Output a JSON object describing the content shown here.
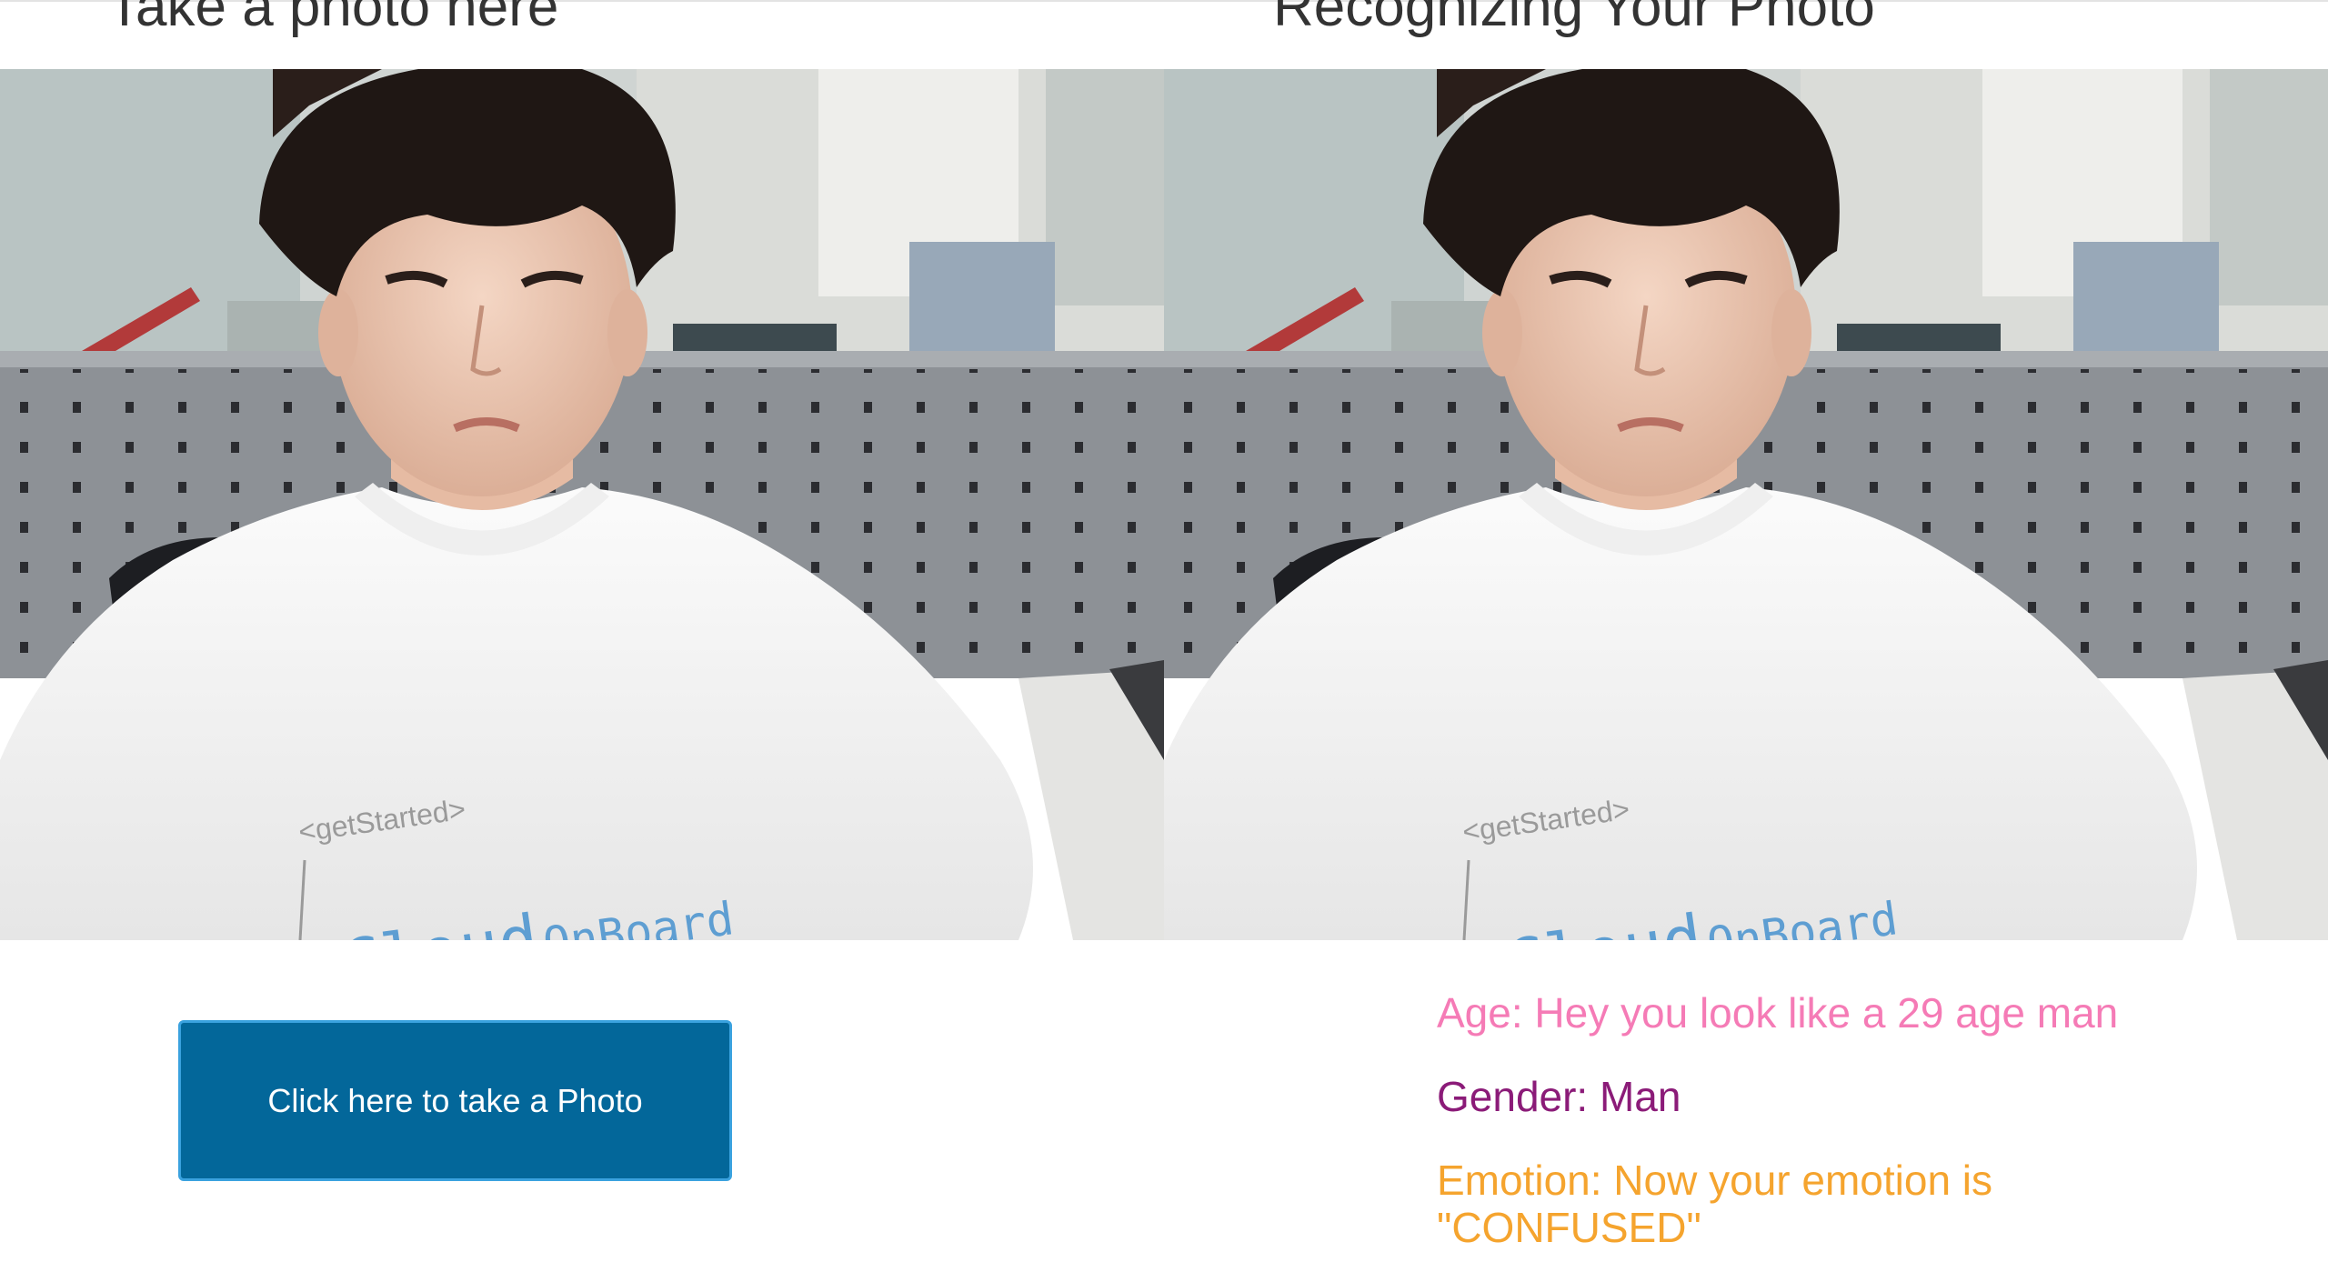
{
  "left_panel": {
    "title": "Take a photo here",
    "button_label": "Click here to take a Photo"
  },
  "right_panel": {
    "title": "Recognizing Your Photo",
    "results": {
      "age": "Age: Hey you look like a 29 age man",
      "gender": "Gender: Man",
      "emotion_line1": "Emotion: Now your emotion is",
      "emotion_line2": "\"CONFUSED\""
    }
  },
  "photo": {
    "shirt_text_small": "<getStarted>",
    "shirt_text_cloud": "Cloud",
    "shirt_text_onboard": "OnBoard"
  },
  "colors": {
    "button_bg": "#03679a",
    "button_border": "#3aa2df",
    "age_text": "#f57bb6",
    "gender_text": "#8b1b78",
    "emotion_text": "#f5a42e",
    "heading_text": "#333333"
  }
}
